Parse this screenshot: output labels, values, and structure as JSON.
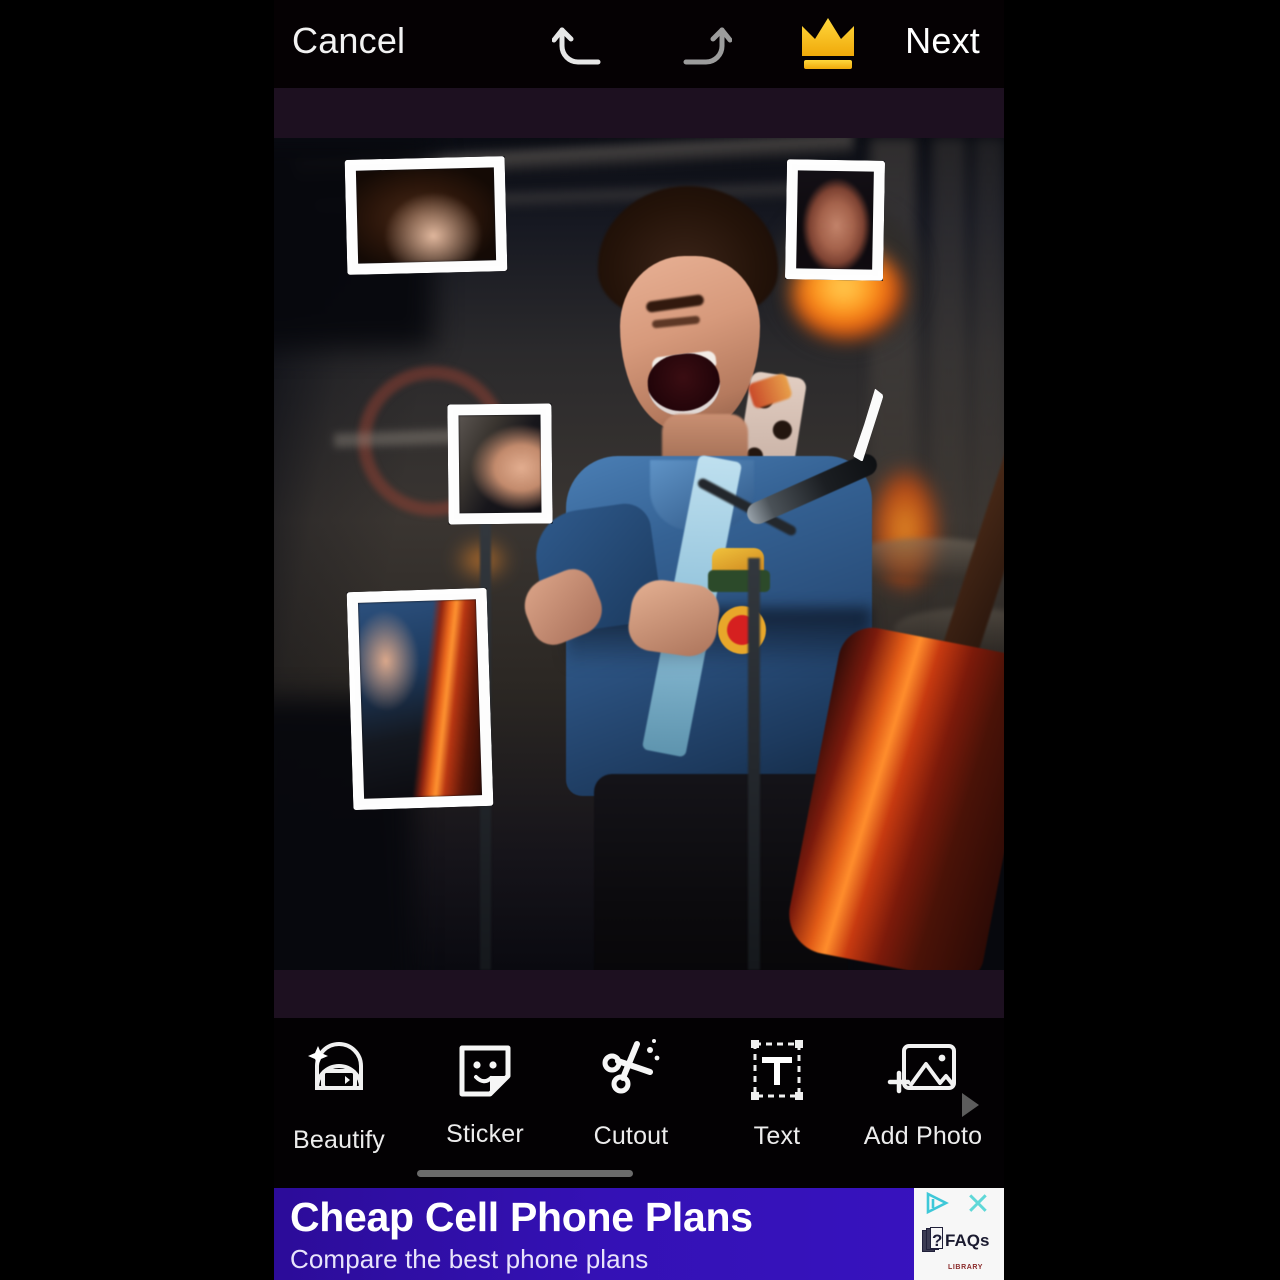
{
  "app": {
    "topbar": {
      "cancel_label": "Cancel",
      "next_label": "Next",
      "undo_icon": "undo-arrow-icon",
      "redo_icon": "redo-arrow-icon",
      "premium_icon": "crown-icon",
      "premium_color": "#f5c018"
    },
    "canvas": {
      "description": "Photo of a young male musician singing into a microphone while playing an orange-red acoustic guitar, wearing a blue denim jacket with patches on a concert stage",
      "background_color": "#1d1020",
      "stickers": [
        {
          "name": "cutout-frame-hair",
          "content": "curly hair crop",
          "border_color": "#fdfdfd"
        },
        {
          "name": "cutout-frame-ear",
          "content": "ear with earpiece crop",
          "border_color": "#fdfdfd"
        },
        {
          "name": "cutout-frame-mouth",
          "content": "singing mouth and mic crop",
          "border_color": "#fdfdfd"
        },
        {
          "name": "cutout-frame-guitar",
          "content": "guitar body and hand crop",
          "border_color": "#fdfdfd"
        },
        {
          "name": "brush-stroke",
          "content": "white curved brush mark",
          "border_color": "#fbfbfb"
        }
      ]
    },
    "toolbar": {
      "items": [
        {
          "label": "Beautify",
          "icon": "beautify-face-icon",
          "selected": false
        },
        {
          "label": "Sticker",
          "icon": "sticker-smiley-icon",
          "selected": false
        },
        {
          "label": "Cutout",
          "icon": "scissors-icon",
          "selected": false
        },
        {
          "label": "Text",
          "icon": "text-box-icon",
          "selected": false
        },
        {
          "label": "Add Photo",
          "icon": "add-photo-icon",
          "selected": false
        }
      ],
      "scroll_arrow_icon": "chevron-right-icon",
      "scroll_indicator": true
    },
    "ad": {
      "title": "Cheap Cell Phone Plans",
      "subtitle": "Compare the best phone plans",
      "brand": "FAQs",
      "brand_sub": "LIBRARY",
      "brand_mark": "?",
      "adchoices_icon": "adchoices-icon",
      "close_label": "✕",
      "background_color": "#3411b5"
    }
  }
}
